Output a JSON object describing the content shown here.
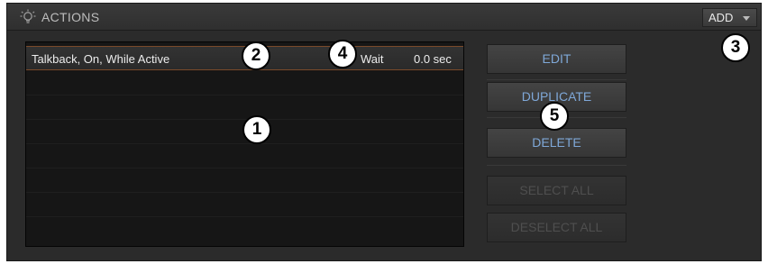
{
  "panel": {
    "title": "ACTIONS",
    "add_label": "ADD"
  },
  "actions": [
    {
      "name": "Talkback, On, While Active",
      "wait_label": "Wait",
      "duration": "0.0 sec"
    }
  ],
  "buttons": {
    "edit": "EDIT",
    "duplicate": "DUPLICATE",
    "delete": "DELETE",
    "select_all": "SELECT ALL",
    "deselect_all": "DESELECT ALL"
  },
  "callouts": {
    "c1": "1",
    "c2": "2",
    "c3": "3",
    "c4": "4",
    "c5": "5"
  },
  "colors": {
    "accent_text": "#7fa8d8",
    "selection_border": "#7a4a2a"
  }
}
